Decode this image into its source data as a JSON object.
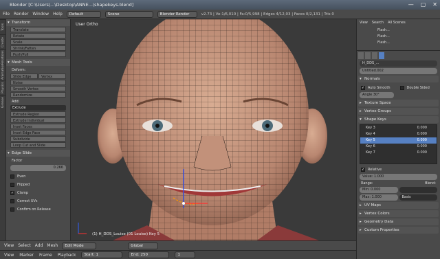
{
  "window": {
    "title": "Blender [C:\\Users\\...\\Desktop\\ANNE...\\shapekeys.blend]",
    "controls": [
      "—",
      "▢",
      "✕"
    ]
  },
  "infobar": {
    "menus": [
      "File",
      "Render",
      "Window",
      "Help"
    ],
    "layout": "Default",
    "scene": "Scene",
    "engine": "Blender Render",
    "stats": "v2.73 | Ve:1/6,010 | Fa:0/5,998 | Edges 4/12,03 | Faces 0/2,131 | Tris 0"
  },
  "tabs": [
    "Tools",
    "Create",
    "Relations",
    "Animation",
    "Physics",
    "Grease"
  ],
  "toolshelf": {
    "transform_header": "Transform",
    "transform_buttons": [
      "Translate",
      "Rotate",
      "Scale",
      "Shrink/Fatten",
      "Push/Pull"
    ],
    "mesh_tools_header": "Mesh Tools",
    "deform_label": "Deform:",
    "slide_edge": "Slide Edge",
    "vertex": "Vertex",
    "noise": "Noise",
    "smooth_vertex": "Smooth Vertex",
    "randomize": "Randomize",
    "add_label": "Add:",
    "extrude_dropdown": "Extrude",
    "add_buttons": [
      "Extrude Region",
      "Extrude Individual",
      "Inset Faces",
      "Inset Edge Face",
      "Subdivide",
      "Loop Cut and Slide"
    ],
    "edge_slide_header": "Edge Slide",
    "factor_label": "Factor",
    "factor_value": "0.266",
    "checkboxes": [
      {
        "label": "Even",
        "checked": false
      },
      {
        "label": "Flipped",
        "checked": false
      },
      {
        "label": "Clamp",
        "checked": true
      },
      {
        "label": "Correct UVs",
        "checked": false
      },
      {
        "label": "Confirm on Release",
        "checked": false
      }
    ]
  },
  "viewport": {
    "label": "User Ortho",
    "status": "(1) H_DDS_Louise (01 Louise) Key 5"
  },
  "vpheader": {
    "items": [
      "View",
      "Select",
      "Add",
      "Mesh"
    ],
    "mode": "Edit Mode",
    "pivot": "Global"
  },
  "timeline": {
    "items": [
      "View",
      "Marker",
      "Frame",
      "Playback"
    ],
    "start_label": "Start:",
    "start_value": "1",
    "end_label": "End:",
    "end_value": "250",
    "frame_value": "1"
  },
  "outliner": {
    "menus": [
      "View",
      "Search",
      "All Scenes"
    ],
    "items": [
      "Flash...",
      "Flash...",
      "Flash..."
    ]
  },
  "props": {
    "object_name": "H_DDS_...",
    "data_name": "Untitled.002",
    "normals_header": "Normals",
    "auto_smooth": "Auto Smooth",
    "double_sided": "Double Sided",
    "angle_label": "Angle",
    "angle_value": "30°",
    "sections_closed": [
      "Texture Space",
      "Vertex Groups"
    ],
    "shape_keys_header": "Shape Keys",
    "keys": [
      {
        "name": "Key 3",
        "value": "0.000"
      },
      {
        "name": "Key 4",
        "value": "0.000"
      },
      {
        "name": "Key 5",
        "value": "0.000",
        "active": true
      },
      {
        "name": "Key 6",
        "value": "0.000"
      },
      {
        "name": "Key 7",
        "value": "0.000"
      }
    ],
    "relative_label": "Relative",
    "value_label": "Value:",
    "value_value": "1.000",
    "range_label": "Range:",
    "blend_label": "Blend:",
    "min_label": "Min:",
    "min_value": "0.000",
    "max_label": "Max:",
    "max_value": "1.000",
    "relative_to": "Basis",
    "sections_bottom": [
      "UV Maps",
      "Vertex Colors",
      "Geometry Data",
      "Custom Properties"
    ]
  },
  "colors": {
    "active_key": "#5680c2",
    "skin": "#c99b80",
    "wire": "#1a1a1a"
  }
}
